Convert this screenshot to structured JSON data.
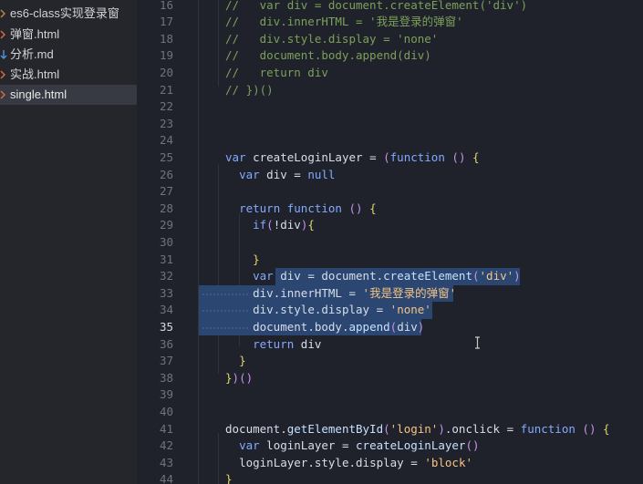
{
  "sidebar": {
    "files": [
      {
        "name": "es6-class实现登录窗",
        "icon": "chevron-right-icon"
      },
      {
        "name": "弹窗.html",
        "icon": "html-file-icon"
      },
      {
        "name": "分析.md",
        "icon": "markdown-file-icon"
      },
      {
        "name": "实战.html",
        "icon": "html-file-icon"
      },
      {
        "name": "single.html",
        "icon": "html-file-icon",
        "selected": true
      }
    ]
  },
  "editor": {
    "active_line": 35,
    "line_numbers": [
      "16",
      "17",
      "18",
      "19",
      "20",
      "21",
      "22",
      "23",
      "24",
      "25",
      "26",
      "27",
      "28",
      "29",
      "30",
      "31",
      "32",
      "33",
      "34",
      "35",
      "36",
      "37",
      "38",
      "39",
      "40",
      "41",
      "42",
      "43",
      "44"
    ],
    "lines": [
      "//   var div = document.createElement('div')",
      "//   div.innerHTML = '我是登录的弹窗'",
      "//   div.style.display = 'none'",
      "//   document.body.append(div)",
      "//   return div",
      "// })()",
      "",
      "",
      "",
      "var createLoginLayer = (function () {",
      "  var div = null",
      "",
      "  return function () {",
      "    if(!div){",
      "",
      "    }",
      "    var div = document.createElement('div')",
      "    div.innerHTML = '我是登录的弹窗'",
      "    div.style.display = 'none'",
      "    document.body.append(div)",
      "    return div",
      "  }",
      "})()",
      "",
      "",
      "document.getElementById('login').onclick = function () {",
      "  var loginLayer = createLoginLayer()",
      "  loginLayer.style.display = 'block'",
      "}"
    ]
  }
}
